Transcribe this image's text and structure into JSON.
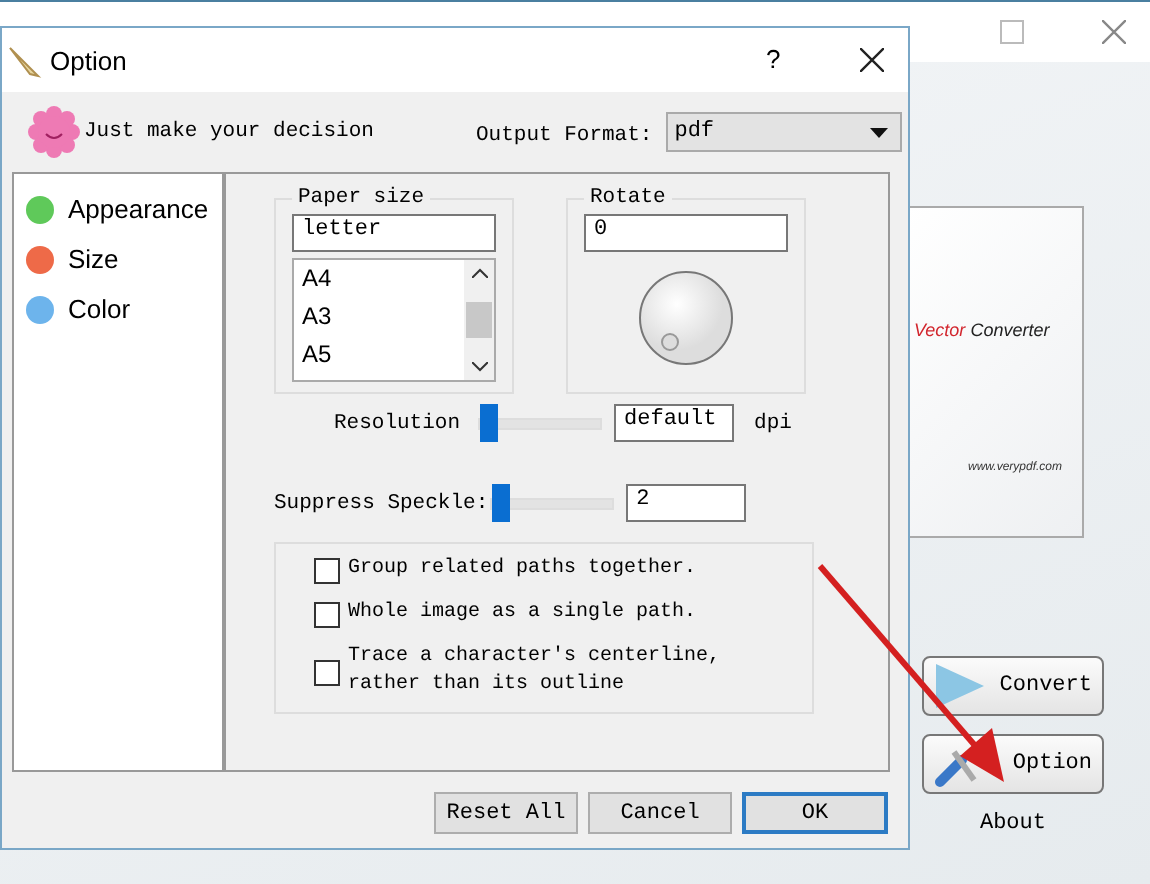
{
  "background": {
    "logo_word_1": "Vector",
    "logo_word_2": "Converter",
    "url": "www.verypdf.com",
    "side_buttons": [
      {
        "label": "Convert",
        "kind": "convert"
      },
      {
        "label": "Option",
        "kind": "option"
      }
    ],
    "about": "About"
  },
  "dialog": {
    "title": "Option",
    "help": "?",
    "tagline": "Just make your decision",
    "output_format": {
      "label": "Output Format:",
      "value": "pdf"
    },
    "sidebar": [
      {
        "label": "Appearance",
        "color": "#5fc95a"
      },
      {
        "label": "Size",
        "color": "#ee6a48"
      },
      {
        "label": "Color",
        "color": "#6db4ec"
      }
    ],
    "paper_size": {
      "title": "Paper size",
      "value": "letter",
      "options": [
        "A4",
        "A3",
        "A5"
      ]
    },
    "rotate": {
      "title": "Rotate",
      "value": "0"
    },
    "resolution": {
      "label": "Resolution",
      "value": "default",
      "unit": "dpi",
      "level": 0
    },
    "speckle": {
      "label": "Suppress Speckle:",
      "value": "2",
      "level": 0
    },
    "options": [
      {
        "label": "Group related paths together.",
        "checked": false
      },
      {
        "label": "Whole image as a single path.",
        "checked": false
      },
      {
        "label": "Trace a character's centerline,\nrather than its outline",
        "checked": false
      }
    ],
    "buttons": [
      {
        "label": "Reset All",
        "kind": "normal"
      },
      {
        "label": "Cancel",
        "kind": "normal"
      },
      {
        "label": "OK",
        "kind": "default"
      }
    ]
  }
}
